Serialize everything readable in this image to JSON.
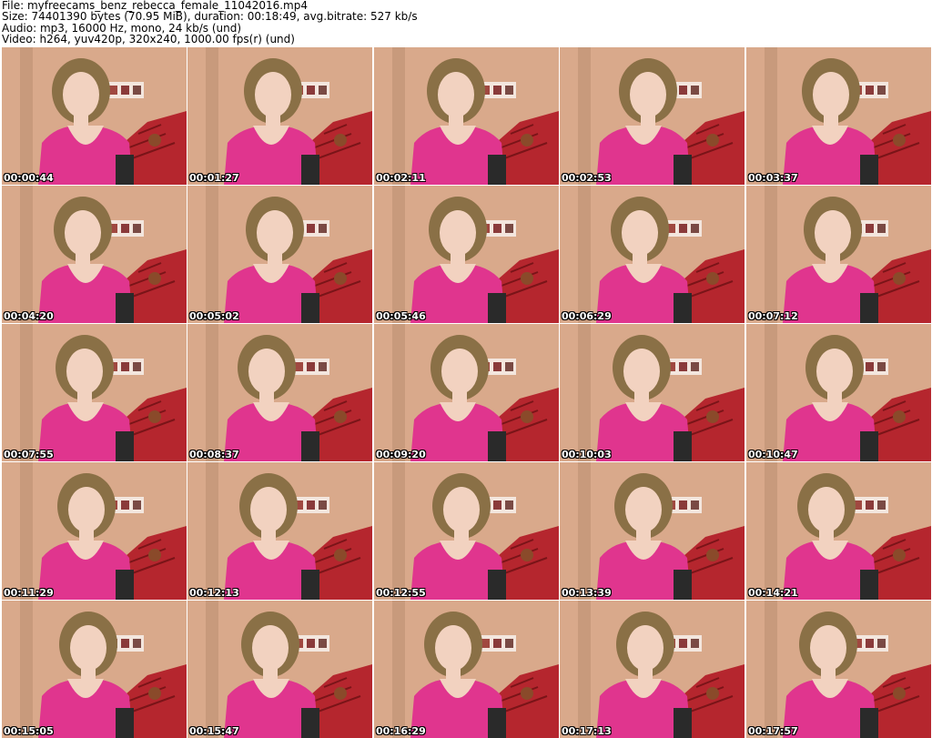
{
  "header": {
    "file_line": "File: myfreecams_benz_rebecca_female_11042016.mp4",
    "size_line": "Size: 74401390 bytes (70.95 MiB), duration: 00:18:49, avg.bitrate: 527 kb/s",
    "audio_line": "Audio: mp3, 16000 Hz, mono, 24 kb/s (und)",
    "video_line": "Video: h264, yuv420p, 320x240, 1000.00 fps(r) (und)"
  },
  "thumbnails": [
    "00:00:44",
    "00:01:27",
    "00:02:11",
    "00:02:53",
    "00:03:37",
    "00:04:20",
    "00:05:02",
    "00:05:46",
    "00:06:29",
    "00:07:12",
    "00:07:55",
    "00:08:37",
    "00:09:20",
    "00:10:03",
    "00:10:47",
    "00:11:29",
    "00:12:13",
    "00:12:55",
    "00:13:39",
    "00:14:21",
    "00:15:05",
    "00:15:47",
    "00:16:29",
    "00:17:13",
    "00:17:57"
  ],
  "colors": {
    "wall": "#d9a98b",
    "couch": "#b5262e",
    "shirt": "#e0358e",
    "hair": "#8a7046",
    "skin": "#f2d2c0"
  }
}
